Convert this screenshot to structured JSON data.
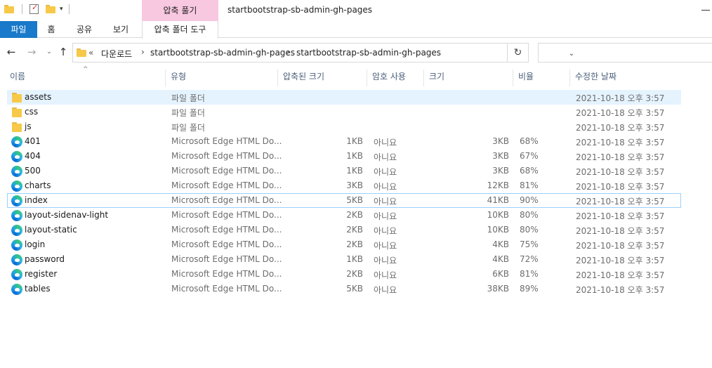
{
  "window": {
    "title": "startbootstrap-sb-admin-gh-pages",
    "context_tab_header": "압축 풀기"
  },
  "ribbon": {
    "tabs": [
      "파일",
      "홈",
      "공유",
      "보기",
      "압축 폴더 도구"
    ]
  },
  "address": {
    "overflow": "«",
    "crumbs": [
      "다운로드",
      "startbootstrap-sb-admin-gh-pages",
      "startbootstrap-sb-admin-gh-pages"
    ]
  },
  "columns": {
    "name": "이름",
    "type": "유형",
    "packed_size": "압축된 크기",
    "password": "암호 사용",
    "size": "크기",
    "ratio": "비율",
    "modified": "수정한 날짜"
  },
  "files": [
    {
      "name": "assets",
      "icon": "folder-icon",
      "type": "파일 폴더",
      "packed": "",
      "password": "",
      "size": "",
      "ratio": "",
      "modified": "2021-10-18 오후 3:57"
    },
    {
      "name": "css",
      "icon": "folder-icon",
      "type": "파일 폴더",
      "packed": "",
      "password": "",
      "size": "",
      "ratio": "",
      "modified": "2021-10-18 오후 3:57"
    },
    {
      "name": "js",
      "icon": "folder-icon",
      "type": "파일 폴더",
      "packed": "",
      "password": "",
      "size": "",
      "ratio": "",
      "modified": "2021-10-18 오후 3:57"
    },
    {
      "name": "401",
      "icon": "edge-icon",
      "type": "Microsoft Edge HTML Do...",
      "packed": "1KB",
      "password": "아니요",
      "size": "3KB",
      "ratio": "68%",
      "modified": "2021-10-18 오후 3:57"
    },
    {
      "name": "404",
      "icon": "edge-icon",
      "type": "Microsoft Edge HTML Do...",
      "packed": "1KB",
      "password": "아니요",
      "size": "3KB",
      "ratio": "67%",
      "modified": "2021-10-18 오후 3:57"
    },
    {
      "name": "500",
      "icon": "edge-icon",
      "type": "Microsoft Edge HTML Do...",
      "packed": "1KB",
      "password": "아니요",
      "size": "3KB",
      "ratio": "68%",
      "modified": "2021-10-18 오후 3:57"
    },
    {
      "name": "charts",
      "icon": "edge-icon",
      "type": "Microsoft Edge HTML Do...",
      "packed": "3KB",
      "password": "아니요",
      "size": "12KB",
      "ratio": "81%",
      "modified": "2021-10-18 오후 3:57"
    },
    {
      "name": "index",
      "icon": "edge-icon",
      "type": "Microsoft Edge HTML Do...",
      "packed": "5KB",
      "password": "아니요",
      "size": "41KB",
      "ratio": "90%",
      "modified": "2021-10-18 오후 3:57"
    },
    {
      "name": "layout-sidenav-light",
      "icon": "edge-icon",
      "type": "Microsoft Edge HTML Do...",
      "packed": "2KB",
      "password": "아니요",
      "size": "10KB",
      "ratio": "80%",
      "modified": "2021-10-18 오후 3:57"
    },
    {
      "name": "layout-static",
      "icon": "edge-icon",
      "type": "Microsoft Edge HTML Do...",
      "packed": "2KB",
      "password": "아니요",
      "size": "10KB",
      "ratio": "80%",
      "modified": "2021-10-18 오후 3:57"
    },
    {
      "name": "login",
      "icon": "edge-icon",
      "type": "Microsoft Edge HTML Do...",
      "packed": "2KB",
      "password": "아니요",
      "size": "4KB",
      "ratio": "75%",
      "modified": "2021-10-18 오후 3:57"
    },
    {
      "name": "password",
      "icon": "edge-icon",
      "type": "Microsoft Edge HTML Do...",
      "packed": "1KB",
      "password": "아니요",
      "size": "4KB",
      "ratio": "72%",
      "modified": "2021-10-18 오후 3:57"
    },
    {
      "name": "register",
      "icon": "edge-icon",
      "type": "Microsoft Edge HTML Do...",
      "packed": "2KB",
      "password": "아니요",
      "size": "6KB",
      "ratio": "81%",
      "modified": "2021-10-18 오후 3:57"
    },
    {
      "name": "tables",
      "icon": "edge-icon",
      "type": "Microsoft Edge HTML Do...",
      "packed": "5KB",
      "password": "아니요",
      "size": "38KB",
      "ratio": "89%",
      "modified": "2021-10-18 오후 3:57"
    }
  ],
  "selection": {
    "highlighted_row": "assets",
    "focused_row": "index"
  }
}
